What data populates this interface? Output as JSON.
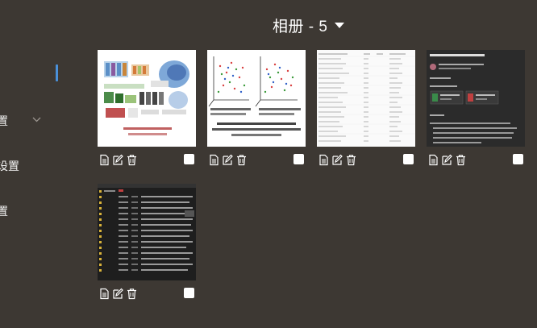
{
  "sidebar": {
    "items": [
      {
        "label": "置"
      },
      {
        "label": "设置"
      },
      {
        "label": "置"
      }
    ]
  },
  "header": {
    "title": "相册 - 5"
  },
  "photos": [
    {
      "type": "diagram"
    },
    {
      "type": "scatter-figure"
    },
    {
      "type": "table-document"
    },
    {
      "type": "dark-document"
    },
    {
      "type": "terminal-listing"
    }
  ],
  "icons": {
    "info": "document-icon",
    "edit": "edit-icon",
    "delete": "trash-icon",
    "expand": "chevron-down-icon",
    "album_menu": "caret-down-icon"
  },
  "colors": {
    "background": "#3d3833",
    "accent": "#4a90d9",
    "text": "#ffffff"
  }
}
